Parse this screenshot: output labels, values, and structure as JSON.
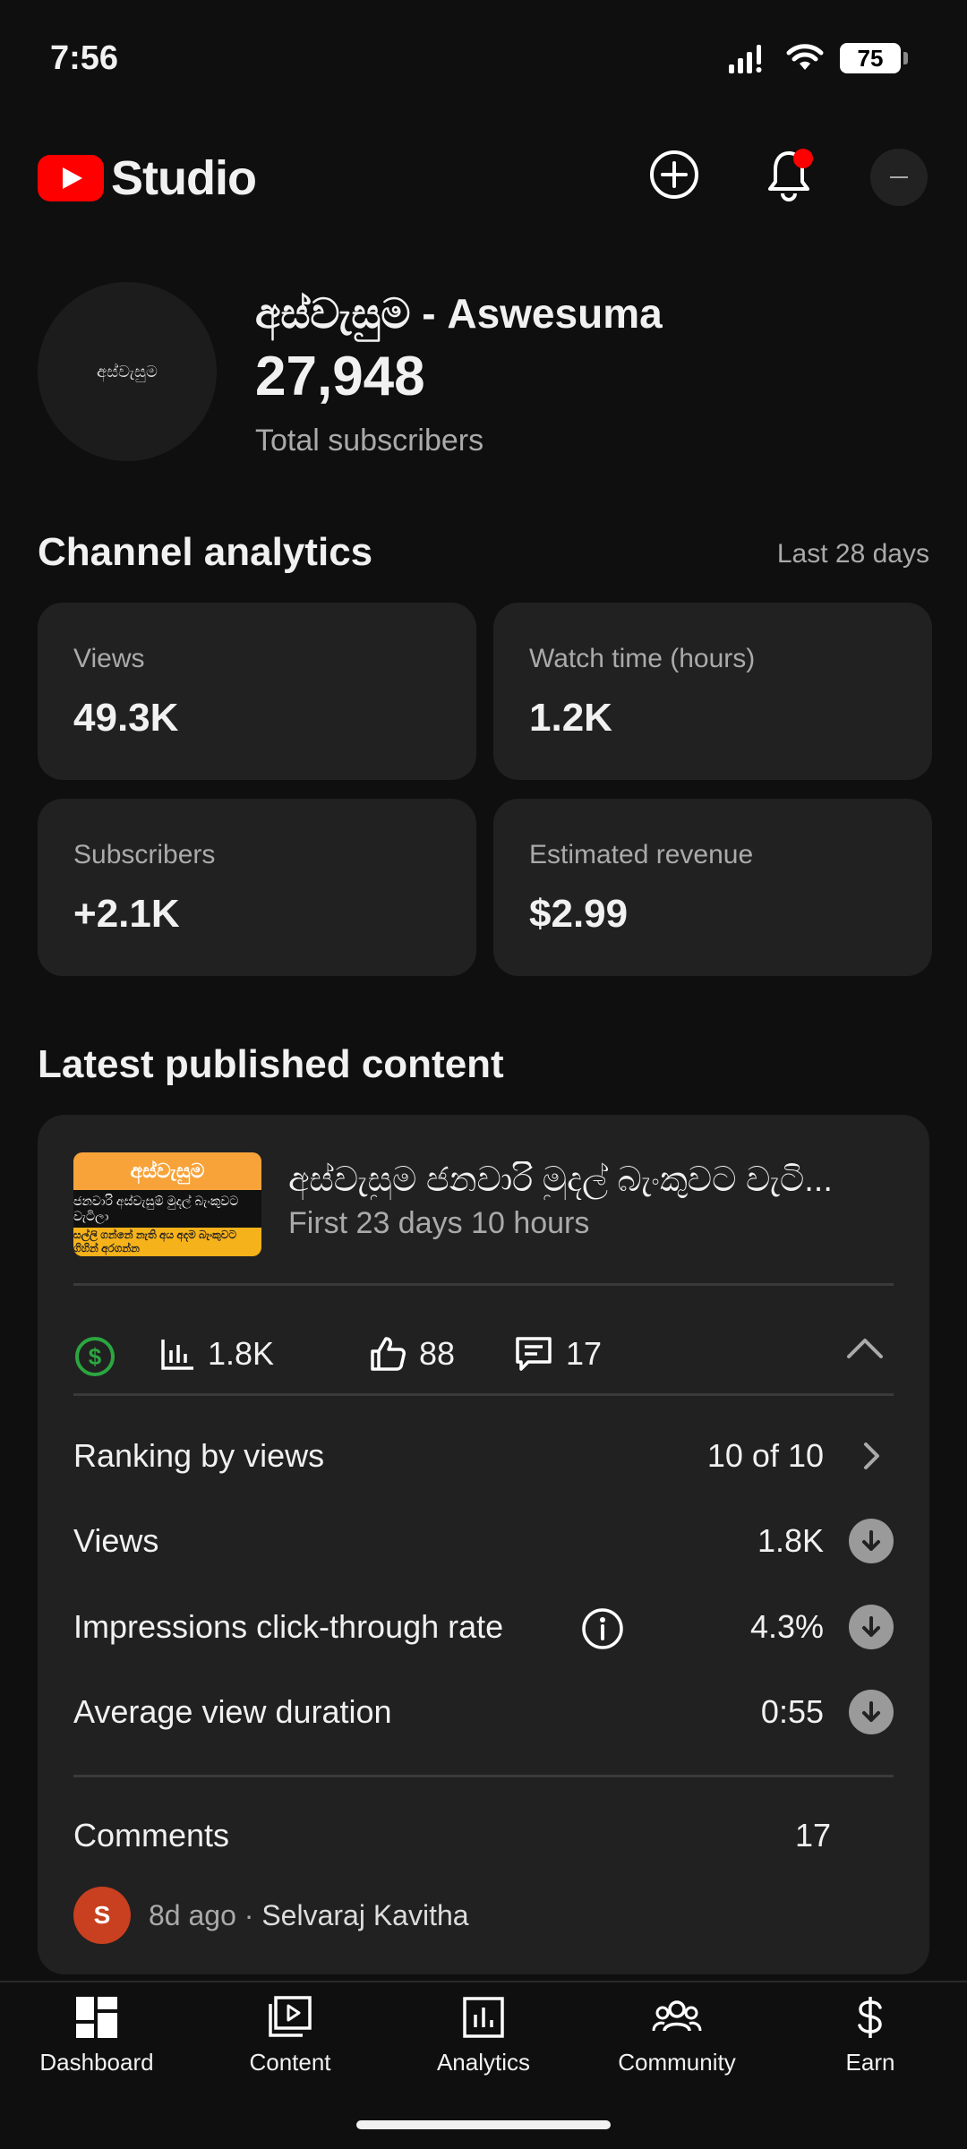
{
  "status_bar": {
    "time": "7:56",
    "battery": "75"
  },
  "header": {
    "logo_text": "Studio"
  },
  "channel": {
    "avatar_text": "අස්වැසුම",
    "name": "අස්වැසුම - Aswesuma",
    "subscribers": "27,948",
    "subscribers_label": "Total subscribers"
  },
  "analytics": {
    "title": "Channel analytics",
    "period": "Last 28 days",
    "cards": [
      {
        "label": "Views",
        "value": "49.3K"
      },
      {
        "label": "Watch time (hours)",
        "value": "1.2K"
      },
      {
        "label": "Subscribers",
        "value": "+2.1K"
      },
      {
        "label": "Estimated revenue",
        "value": "$2.99"
      }
    ]
  },
  "latest": {
    "title": "Latest published content",
    "thumb_top": "අස්වැසුම",
    "thumb_mid": "ජනවාරි අස්වැසුම් මුදල් බැංකුවට වැටිලා",
    "thumb_bot": "සල්ලි ගන්නේ නැති අය අදම බැංකුවට ගිහින් අරගන්න",
    "video_title": "අස්වැසුම ජනවාරි මුදල් බැංකුවට වැටි...",
    "video_subtitle": "First 23 days 10 hours",
    "stats": {
      "views": "1.8K",
      "likes": "88",
      "comments": "17"
    },
    "metrics": [
      {
        "label": "Ranking by views",
        "value": "10 of 10"
      },
      {
        "label": "Views",
        "value": "1.8K"
      },
      {
        "label": "Impressions click-through rate",
        "value": "4.3%"
      },
      {
        "label": "Average view duration",
        "value": "0:55"
      }
    ],
    "comments_label": "Comments",
    "comments_count": "17",
    "comment": {
      "avatar_letter": "S",
      "time": "8d ago",
      "separator": " · ",
      "author": "Selvaraj Kavitha"
    }
  },
  "nav": [
    {
      "label": "Dashboard",
      "icon": "dashboard-icon"
    },
    {
      "label": "Content",
      "icon": "content-icon"
    },
    {
      "label": "Analytics",
      "icon": "analytics-icon"
    },
    {
      "label": "Community",
      "icon": "community-icon"
    },
    {
      "label": "Earn",
      "icon": "earn-icon"
    }
  ],
  "colors": {
    "background": "#0f0f0f",
    "card": "#212121",
    "brand_red": "#ff0000",
    "monetized_green": "#2ba640"
  }
}
